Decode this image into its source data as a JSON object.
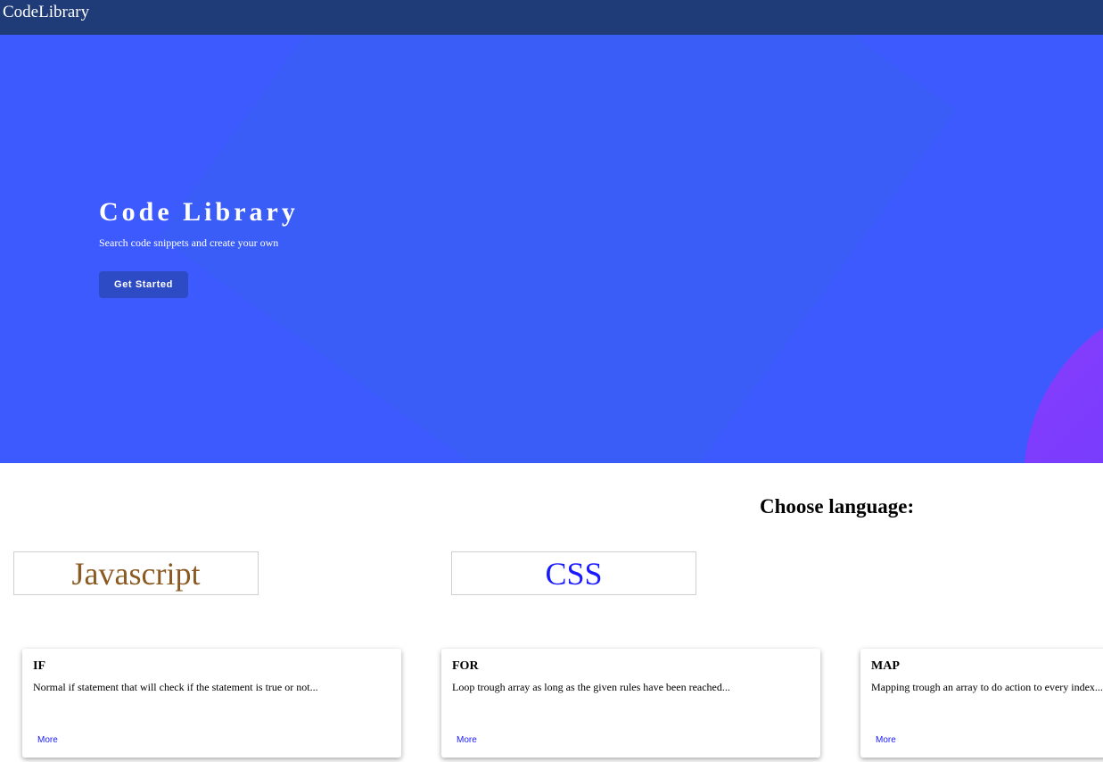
{
  "navbar": {
    "brand": "CodeLibrary"
  },
  "hero": {
    "title": "Code Library",
    "subtitle": "Search code snippets and create your own",
    "button_label": "Get Started"
  },
  "section": {
    "heading": "Choose language:"
  },
  "languages": [
    {
      "label": "Javascript",
      "color": "#8b5a23"
    },
    {
      "label": "CSS",
      "color": "#1a1aff"
    }
  ],
  "cards": [
    {
      "title": "IF",
      "description": "Normal if statement that will check if the statement is true or not...",
      "link": "More"
    },
    {
      "title": "FOR",
      "description": "Loop trough array as long as the given rules have been reached...",
      "link": "More"
    },
    {
      "title": "MAP",
      "description": "Mapping trough an array to do action to every index...",
      "link": "More"
    }
  ],
  "colors": {
    "navbar": "#1f3c78",
    "hero": "#3d5afe",
    "button": "#2e4bc6",
    "link": "#1a1aff"
  }
}
